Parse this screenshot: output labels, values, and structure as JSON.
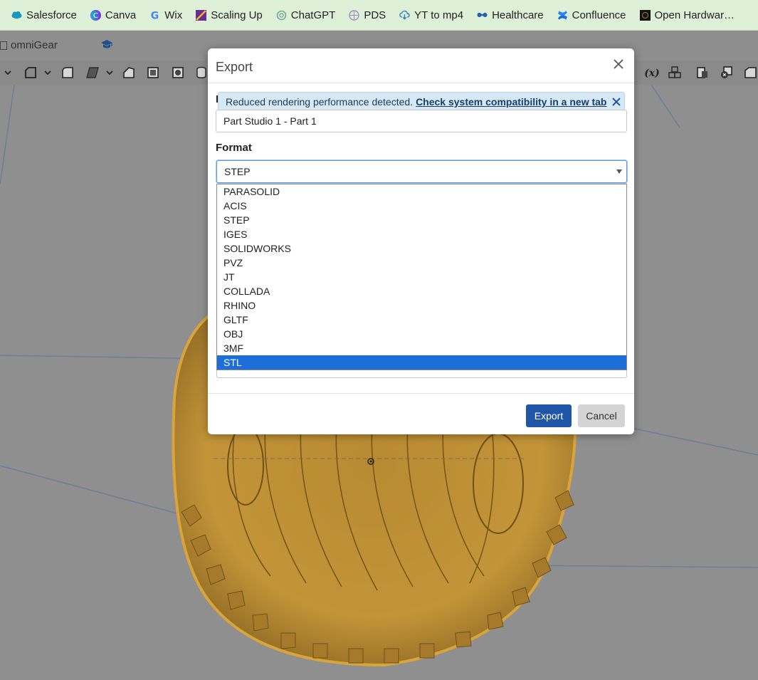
{
  "bookmarks": [
    {
      "label": "Salesforce",
      "icon": "salesforce-cloud-icon",
      "color": "#1798c1"
    },
    {
      "label": "Canva",
      "icon": "canva-icon",
      "color": "#7d2ae8"
    },
    {
      "label": "Wix",
      "icon": "google-icon",
      "color": "#4285f4"
    },
    {
      "label": "Scaling Up",
      "icon": "scaling-up-icon",
      "color": "#6a2d8f"
    },
    {
      "label": "ChatGPT",
      "icon": "chatgpt-icon",
      "color": "#74aa9c"
    },
    {
      "label": "PDS",
      "icon": "pds-icon",
      "color": "#9c8fb5"
    },
    {
      "label": "YT to mp4",
      "icon": "download-cloud-icon",
      "color": "#2a7fc4"
    },
    {
      "label": "Healthcare",
      "icon": "healthcare-icon",
      "color": "#2a5fb0"
    },
    {
      "label": "Confluence",
      "icon": "confluence-icon",
      "color": "#1c6fd8"
    },
    {
      "label": "Open Hardwar…",
      "icon": "open-hardware-icon",
      "color": "#111111"
    }
  ],
  "document": {
    "name": "omniGear"
  },
  "dialog": {
    "title": "Export",
    "name_label_fragment": "I",
    "banner": {
      "text": "Reduced rendering performance detected.",
      "link": "Check system compatibility in a new tab"
    },
    "name_value": "Part Studio 1 - Part 1",
    "format_label": "Format",
    "format_value": "STEP",
    "export_label": "Export",
    "cancel_label": "Cancel"
  },
  "format_options": [
    "PARASOLID",
    "ACIS",
    "STEP",
    "IGES",
    "SOLIDWORKS",
    "PVZ",
    "JT",
    "COLLADA",
    "RHINO",
    "GLTF",
    "OBJ",
    "3MF",
    "STL"
  ],
  "highlighted_option": "STL",
  "colors": {
    "accent": "#1f56a8",
    "highlight": "#1d6ed8",
    "model": "#c9962e",
    "bookmark_bar": "#dff0d8"
  }
}
